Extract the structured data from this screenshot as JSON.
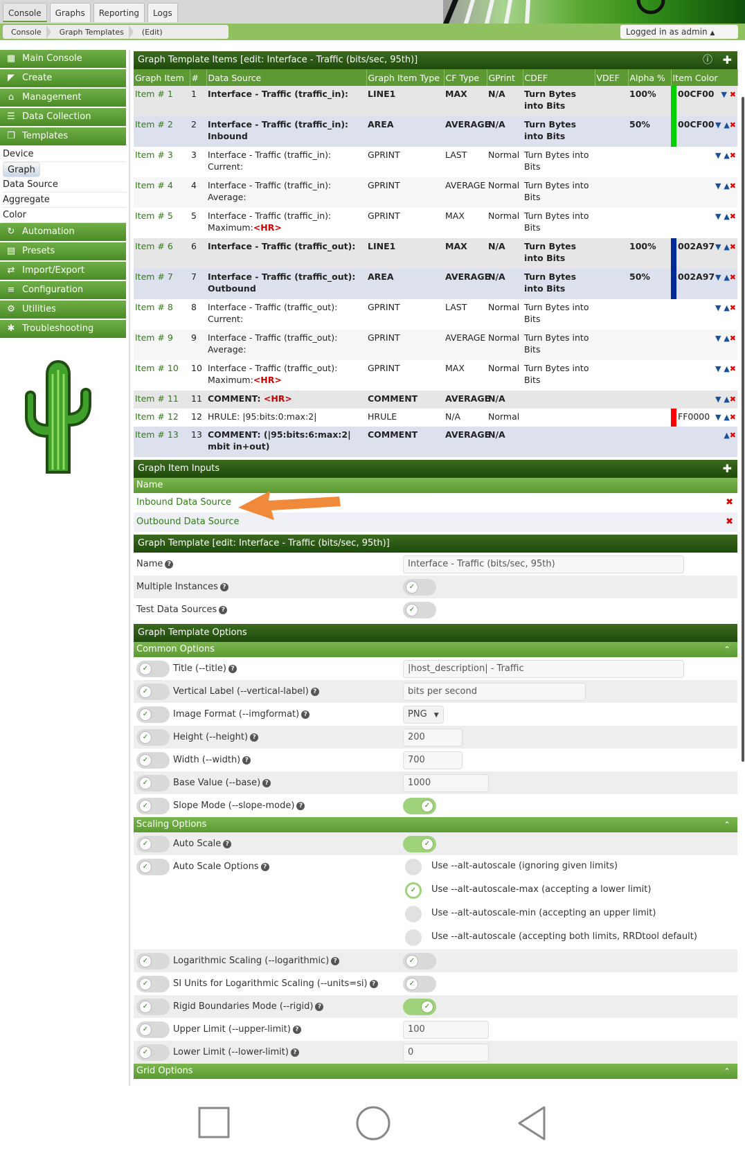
{
  "tabs": [
    "Console",
    "Graphs",
    "Reporting",
    "Logs"
  ],
  "breadcrumb": [
    "Console",
    "Graph Templates",
    "(Edit)"
  ],
  "login_text": "Logged in as admin",
  "sidebar": {
    "main_console": "Main Console",
    "create": "Create",
    "management": "Management",
    "data_collection": "Data Collection",
    "templates": "Templates",
    "template_items": [
      "Device",
      "Graph",
      "Data Source",
      "Aggregate",
      "Color"
    ],
    "automation": "Automation",
    "presets": "Presets",
    "import_export": "Import/Export",
    "configuration": "Configuration",
    "utilities": "Utilities",
    "troubleshooting": "Troubleshooting"
  },
  "items_panel": {
    "title": "Graph Template Items [edit: Interface - Traffic (bits/sec, 95th)]",
    "columns": [
      "Graph Item",
      "#",
      "Data Source",
      "Graph Item Type",
      "CF Type",
      "GPrint",
      "CDEF",
      "VDEF",
      "Alpha %",
      "Item Color"
    ]
  },
  "items": [
    {
      "item": "Item # 1",
      "num": "1",
      "ds": "Interface - Traffic (traffic_in):",
      "ds_hr": "",
      "type": "LINE1",
      "cf": "MAX",
      "gprint": "N/A",
      "cdef": "Turn Bytes into Bits",
      "alpha": "100%",
      "color": "00CF00",
      "hex": "#00CF00"
    },
    {
      "item": "Item # 2",
      "num": "2",
      "ds": "Interface - Traffic (traffic_in): Inbound",
      "ds_hr": "",
      "type": "AREA",
      "cf": "AVERAGE",
      "gprint": "N/A",
      "cdef": "Turn Bytes into Bits",
      "alpha": "50%",
      "color": "00CF00",
      "hex": "#00CF00"
    },
    {
      "item": "Item # 3",
      "num": "3",
      "ds": "Interface - Traffic (traffic_in): Current:",
      "ds_hr": "",
      "type": "GPRINT",
      "cf": "LAST",
      "gprint": "Normal",
      "cdef": "Turn Bytes into Bits",
      "alpha": "",
      "color": "",
      "hex": ""
    },
    {
      "item": "Item # 4",
      "num": "4",
      "ds": "Interface - Traffic (traffic_in): Average:",
      "ds_hr": "",
      "type": "GPRINT",
      "cf": "AVERAGE",
      "gprint": "Normal",
      "cdef": "Turn Bytes into Bits",
      "alpha": "",
      "color": "",
      "hex": ""
    },
    {
      "item": "Item # 5",
      "num": "5",
      "ds": "Interface - Traffic (traffic_in): Maximum:",
      "ds_hr": "<HR>",
      "type": "GPRINT",
      "cf": "MAX",
      "gprint": "Normal",
      "cdef": "Turn Bytes into Bits",
      "alpha": "",
      "color": "",
      "hex": ""
    },
    {
      "item": "Item # 6",
      "num": "6",
      "ds": "Interface - Traffic (traffic_out):",
      "ds_hr": "",
      "type": "LINE1",
      "cf": "MAX",
      "gprint": "N/A",
      "cdef": "Turn Bytes into Bits",
      "alpha": "100%",
      "color": "002A97",
      "hex": "#002A97"
    },
    {
      "item": "Item # 7",
      "num": "7",
      "ds": "Interface - Traffic (traffic_out): Outbound",
      "ds_hr": "",
      "type": "AREA",
      "cf": "AVERAGE",
      "gprint": "N/A",
      "cdef": "Turn Bytes into Bits",
      "alpha": "50%",
      "color": "002A97",
      "hex": "#002A97"
    },
    {
      "item": "Item # 8",
      "num": "8",
      "ds": "Interface - Traffic (traffic_out): Current:",
      "ds_hr": "",
      "type": "GPRINT",
      "cf": "LAST",
      "gprint": "Normal",
      "cdef": "Turn Bytes into Bits",
      "alpha": "",
      "color": "",
      "hex": ""
    },
    {
      "item": "Item # 9",
      "num": "9",
      "ds": "Interface - Traffic (traffic_out): Average:",
      "ds_hr": "",
      "type": "GPRINT",
      "cf": "AVERAGE",
      "gprint": "Normal",
      "cdef": "Turn Bytes into Bits",
      "alpha": "",
      "color": "",
      "hex": ""
    },
    {
      "item": "Item # 10",
      "num": "10",
      "ds": "Interface - Traffic (traffic_out): Maximum:",
      "ds_hr": "<HR>",
      "type": "GPRINT",
      "cf": "MAX",
      "gprint": "Normal",
      "cdef": "Turn Bytes into Bits",
      "alpha": "",
      "color": "",
      "hex": ""
    },
    {
      "item": "Item # 11",
      "num": "11",
      "ds": "COMMENT: ",
      "ds_hr": "<HR>",
      "type": "COMMENT",
      "cf": "AVERAGE",
      "gprint": "N/A",
      "cdef": "",
      "alpha": "",
      "color": "",
      "hex": ""
    },
    {
      "item": "Item # 12",
      "num": "12",
      "ds": "HRULE: |95:bits:0:max:2|",
      "ds_hr": "",
      "type": "HRULE",
      "cf": "N/A",
      "gprint": "Normal",
      "cdef": "",
      "alpha": "",
      "color": "FF0000",
      "hex": "#FF0000"
    },
    {
      "item": "Item # 13",
      "num": "13",
      "ds": "COMMENT: (|95:bits:6:max:2| mbit in+out)",
      "ds_hr": "",
      "type": "COMMENT",
      "cf": "AVERAGE",
      "gprint": "N/A",
      "cdef": "",
      "alpha": "",
      "color": "",
      "hex": ""
    }
  ],
  "inputs_panel": {
    "title": "Graph Item Inputs",
    "col_name": "Name",
    "rows": [
      "Inbound Data Source",
      "Outbound Data Source"
    ]
  },
  "template_panel": {
    "title": "Graph Template [edit: Interface - Traffic (bits/sec, 95th)]",
    "name_label": "Name",
    "name_value": "Interface - Traffic (bits/sec, 95th)",
    "multi_label": "Multiple Instances",
    "test_label": "Test Data Sources"
  },
  "options_panel": {
    "title": "Graph Template Options",
    "common": "Common Options",
    "title_label": "Title (--title)",
    "title_value": "|host_description| - Traffic",
    "vlabel_label": "Vertical Label (--vertical-label)",
    "vlabel_value": "bits per second",
    "imgformat_label": "Image Format (--imgformat)",
    "imgformat_value": "PNG",
    "height_label": "Height (--height)",
    "height_value": "200",
    "width_label": "Width (--width)",
    "width_value": "700",
    "base_label": "Base Value (--base)",
    "base_value": "1000",
    "slope_label": "Slope Mode (--slope-mode)",
    "scaling": "Scaling Options",
    "autoscale_label": "Auto Scale",
    "autoscale_opts_label": "Auto Scale Options",
    "radio_opts": [
      "Use --alt-autoscale (ignoring given limits)",
      "Use --alt-autoscale-max (accepting a lower limit)",
      "Use --alt-autoscale-min (accepting an upper limit)",
      "Use --alt-autoscale (accepting both limits, RRDtool default)"
    ],
    "log_label": "Logarithmic Scaling (--logarithmic)",
    "si_label": "SI Units for Logarithmic Scaling (--units=si)",
    "rigid_label": "Rigid Boundaries Mode (--rigid)",
    "upper_label": "Upper Limit (--upper-limit)",
    "upper_value": "100",
    "lower_label": "Lower Limit (--lower-limit)",
    "lower_value": "0",
    "grid": "Grid Options"
  },
  "colors": {
    "accent_green": "#5d9a34",
    "header_dark": "#1e4a0d",
    "delete_red": "#dd0000"
  }
}
